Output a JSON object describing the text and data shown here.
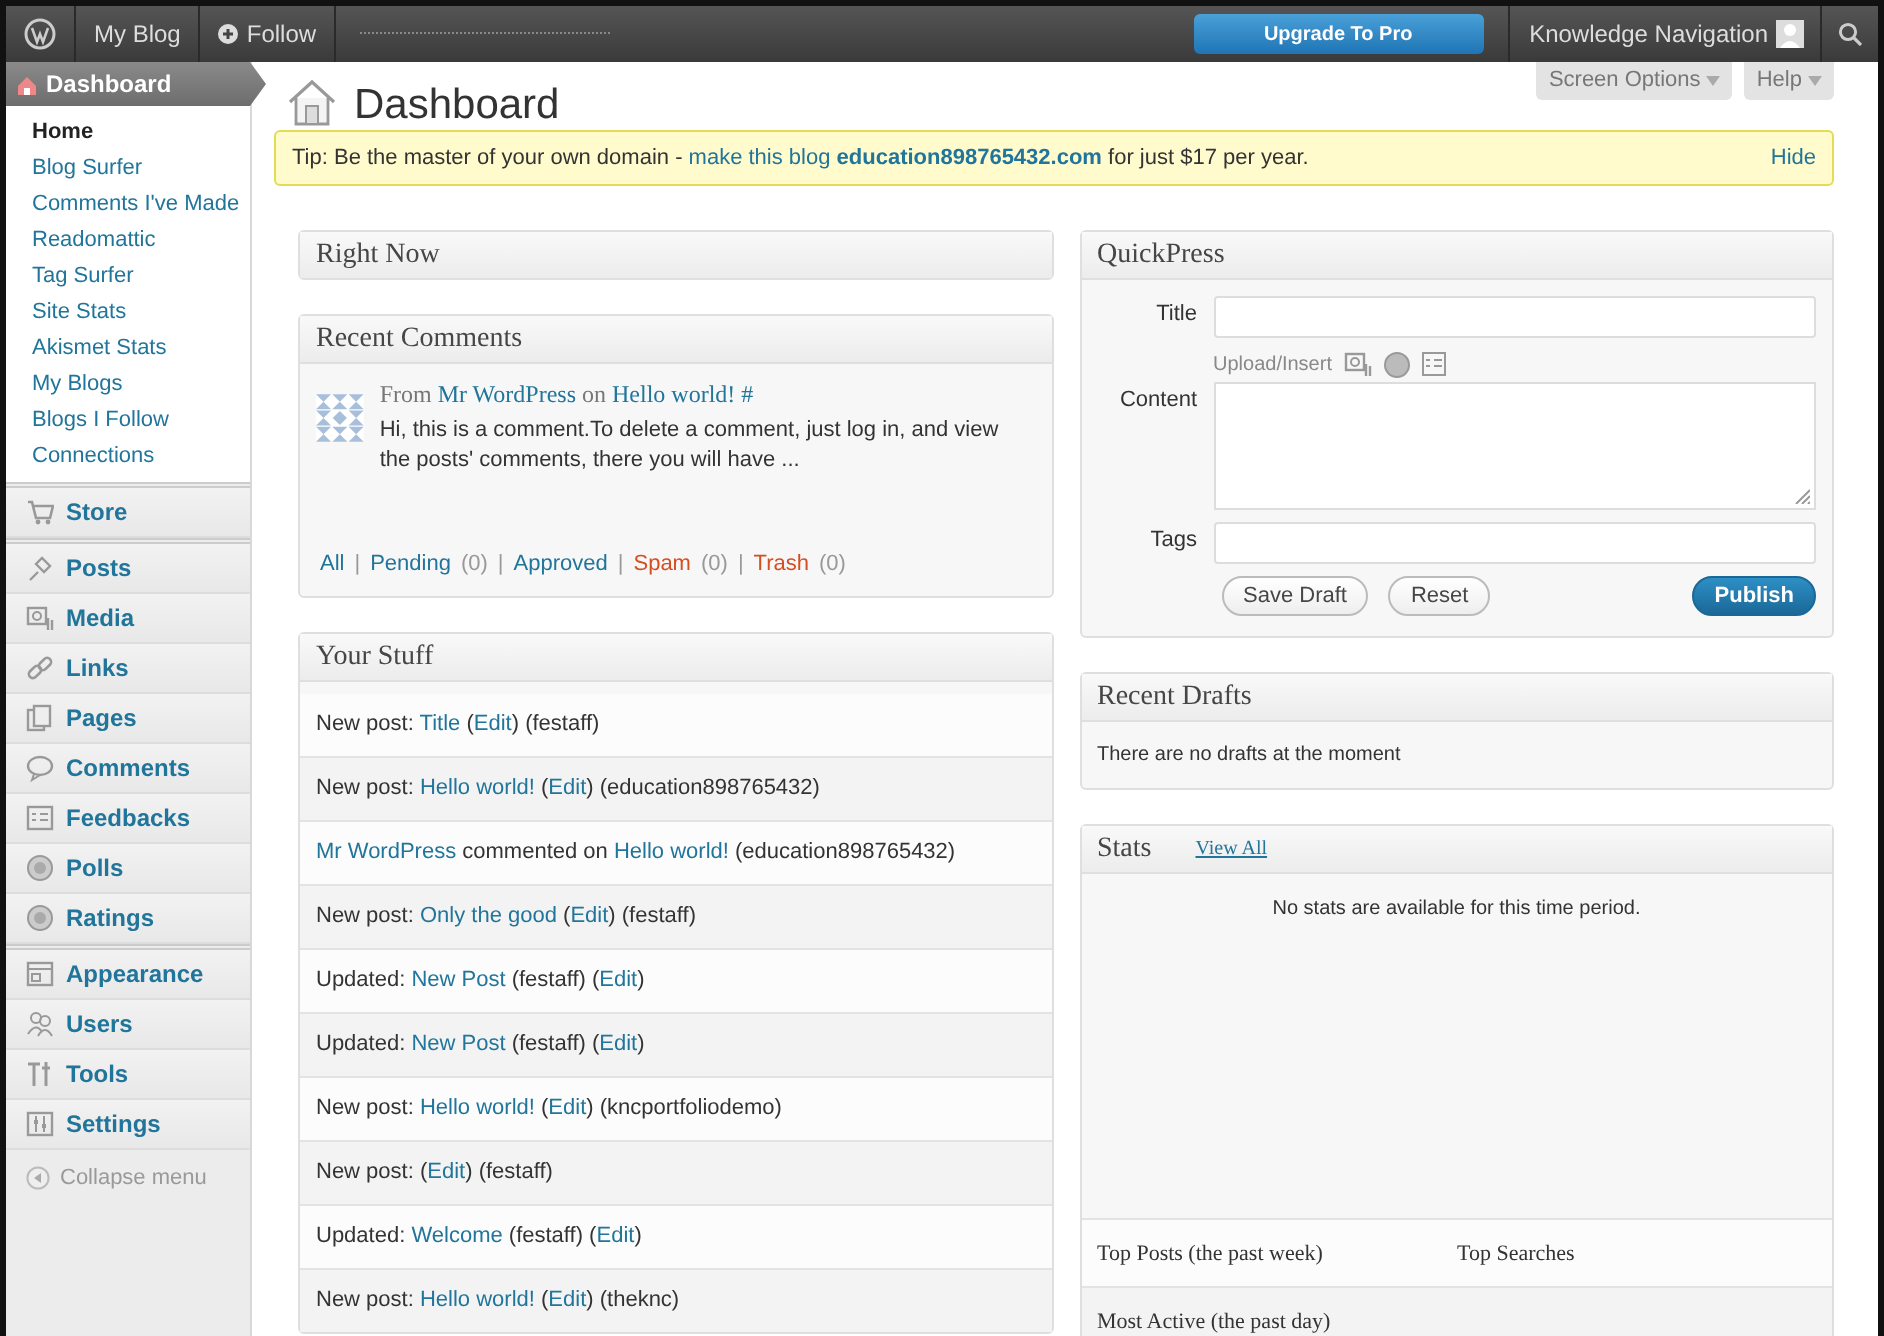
{
  "admin_bar": {
    "site": "My Blog",
    "follow": "Follow",
    "upgrade": "Upgrade To Pro",
    "user": "Knowledge Navigation"
  },
  "sidebar": {
    "dashboard": {
      "label": "Dashboard",
      "selected": true
    },
    "submenu": [
      {
        "label": "Home",
        "selected": true
      },
      {
        "label": "Blog Surfer",
        "selected": false
      },
      {
        "label": "Comments I've Made",
        "selected": false
      },
      {
        "label": "Readomattic",
        "selected": false
      },
      {
        "label": "Tag Surfer",
        "selected": false
      },
      {
        "label": "Site Stats",
        "selected": false
      },
      {
        "label": "Akismet Stats",
        "selected": false
      },
      {
        "label": "My Blogs",
        "selected": false
      },
      {
        "label": "Blogs I Follow",
        "selected": false
      },
      {
        "label": "Connections",
        "selected": false
      }
    ],
    "menu_groups": [
      [
        {
          "label": "Store"
        }
      ],
      [
        {
          "label": "Posts"
        },
        {
          "label": "Media"
        },
        {
          "label": "Links"
        },
        {
          "label": "Pages"
        },
        {
          "label": "Comments"
        },
        {
          "label": "Feedbacks"
        },
        {
          "label": "Polls"
        },
        {
          "label": "Ratings"
        }
      ],
      [
        {
          "label": "Appearance"
        },
        {
          "label": "Users"
        },
        {
          "label": "Tools"
        },
        {
          "label": "Settings"
        }
      ]
    ],
    "collapse": "Collapse menu"
  },
  "header": {
    "title": "Dashboard",
    "screen_options": "Screen Options",
    "help": "Help"
  },
  "tip": {
    "text": "Tip: Be the master of your own domain -",
    "link": "make this blog **education898765432.com**",
    "suffix": "for just $17 per year.",
    "dismiss": "Hide"
  },
  "right_now": {
    "title": "Right Now"
  },
  "recent_comments": {
    "title": "Recent Comments",
    "comment": {
      "from": "From",
      "author": "Mr WordPress",
      "on": "on",
      "post": "Hello world!",
      "hash": "#",
      "excerpt": "Hi, this is a comment.To delete a comment, just log in, and view the posts' comments, there you will have ..."
    },
    "filters": [
      {
        "label": "All",
        "kind": "link"
      },
      {
        "label": "|",
        "kind": "sep"
      },
      {
        "label": "Pending",
        "kind": "link"
      },
      {
        "label": "(0)",
        "kind": "count"
      },
      {
        "label": "|",
        "kind": "sep"
      },
      {
        "label": "Approved",
        "kind": "link"
      },
      {
        "label": "|",
        "kind": "sep"
      },
      {
        "label": "Spam",
        "kind": "danger"
      },
      {
        "label": "(0)",
        "kind": "count"
      },
      {
        "label": "|",
        "kind": "sep"
      },
      {
        "label": "Trash",
        "kind": "danger"
      },
      {
        "label": "(0)",
        "kind": "count"
      }
    ]
  },
  "your_stuff": {
    "title": "Your Stuff",
    "items": [
      {
        "parts": [
          {
            "text": "New post: ",
            "kind": "plain"
          },
          {
            "text": "Title",
            "kind": "link"
          },
          {
            "text": " (",
            "kind": "plain"
          },
          {
            "text": "Edit",
            "kind": "link"
          },
          {
            "text": ") (festaff)",
            "kind": "plain"
          }
        ]
      },
      {
        "parts": [
          {
            "text": "New post: ",
            "kind": "plain"
          },
          {
            "text": "Hello world!",
            "kind": "link"
          },
          {
            "text": " (",
            "kind": "plain"
          },
          {
            "text": "Edit",
            "kind": "link"
          },
          {
            "text": ") (education898765432)",
            "kind": "plain"
          }
        ]
      },
      {
        "parts": [
          {
            "text": "Mr WordPress",
            "kind": "link"
          },
          {
            "text": " commented on ",
            "kind": "plain"
          },
          {
            "text": "Hello world!",
            "kind": "link"
          },
          {
            "text": " (education898765432)",
            "kind": "plain"
          }
        ]
      },
      {
        "parts": [
          {
            "text": "New post: ",
            "kind": "plain"
          },
          {
            "text": "Only the good",
            "kind": "link"
          },
          {
            "text": " (",
            "kind": "plain"
          },
          {
            "text": "Edit",
            "kind": "link"
          },
          {
            "text": ") (festaff)",
            "kind": "plain"
          }
        ]
      },
      {
        "parts": [
          {
            "text": "Updated: ",
            "kind": "plain"
          },
          {
            "text": "New Post",
            "kind": "link"
          },
          {
            "text": " (festaff) (",
            "kind": "plain"
          },
          {
            "text": "Edit",
            "kind": "link"
          },
          {
            "text": ")",
            "kind": "plain"
          }
        ]
      },
      {
        "parts": [
          {
            "text": "Updated: ",
            "kind": "plain"
          },
          {
            "text": "New Post",
            "kind": "link"
          },
          {
            "text": " (festaff) (",
            "kind": "plain"
          },
          {
            "text": "Edit",
            "kind": "link"
          },
          {
            "text": ")",
            "kind": "plain"
          }
        ]
      },
      {
        "parts": [
          {
            "text": "New post: ",
            "kind": "plain"
          },
          {
            "text": "Hello world!",
            "kind": "link"
          },
          {
            "text": " (",
            "kind": "plain"
          },
          {
            "text": "Edit",
            "kind": "link"
          },
          {
            "text": ") (kncportfoliodemo)",
            "kind": "plain"
          }
        ]
      },
      {
        "parts": [
          {
            "text": "New post: (",
            "kind": "plain"
          },
          {
            "text": "Edit",
            "kind": "link"
          },
          {
            "text": ") (festaff)",
            "kind": "plain"
          }
        ]
      },
      {
        "parts": [
          {
            "text": "Updated: ",
            "kind": "plain"
          },
          {
            "text": "Welcome",
            "kind": "link"
          },
          {
            "text": " (festaff) (",
            "kind": "plain"
          },
          {
            "text": "Edit",
            "kind": "link"
          },
          {
            "text": ")",
            "kind": "plain"
          }
        ]
      },
      {
        "parts": [
          {
            "text": "New post: ",
            "kind": "plain"
          },
          {
            "text": "Hello world!",
            "kind": "link"
          },
          {
            "text": " (",
            "kind": "plain"
          },
          {
            "text": "Edit",
            "kind": "link"
          },
          {
            "text": ") (theknc)",
            "kind": "plain"
          }
        ]
      }
    ]
  },
  "quickpress": {
    "title": "QuickPress",
    "title_label": "Title",
    "upload_label": "Upload/Insert",
    "content_label": "Content",
    "tags_label": "Tags",
    "save_draft": "Save Draft",
    "reset": "Reset",
    "publish": "Publish"
  },
  "recent_drafts": {
    "title": "Recent Drafts",
    "message": "There are no drafts at the moment"
  },
  "stats": {
    "title": "Stats",
    "view_all": "View All",
    "message": "No stats are available for this time period.",
    "top_posts": "Top Posts (the past week)",
    "top_searches": "Top Searches",
    "most_active": "Most Active (the past day)"
  }
}
